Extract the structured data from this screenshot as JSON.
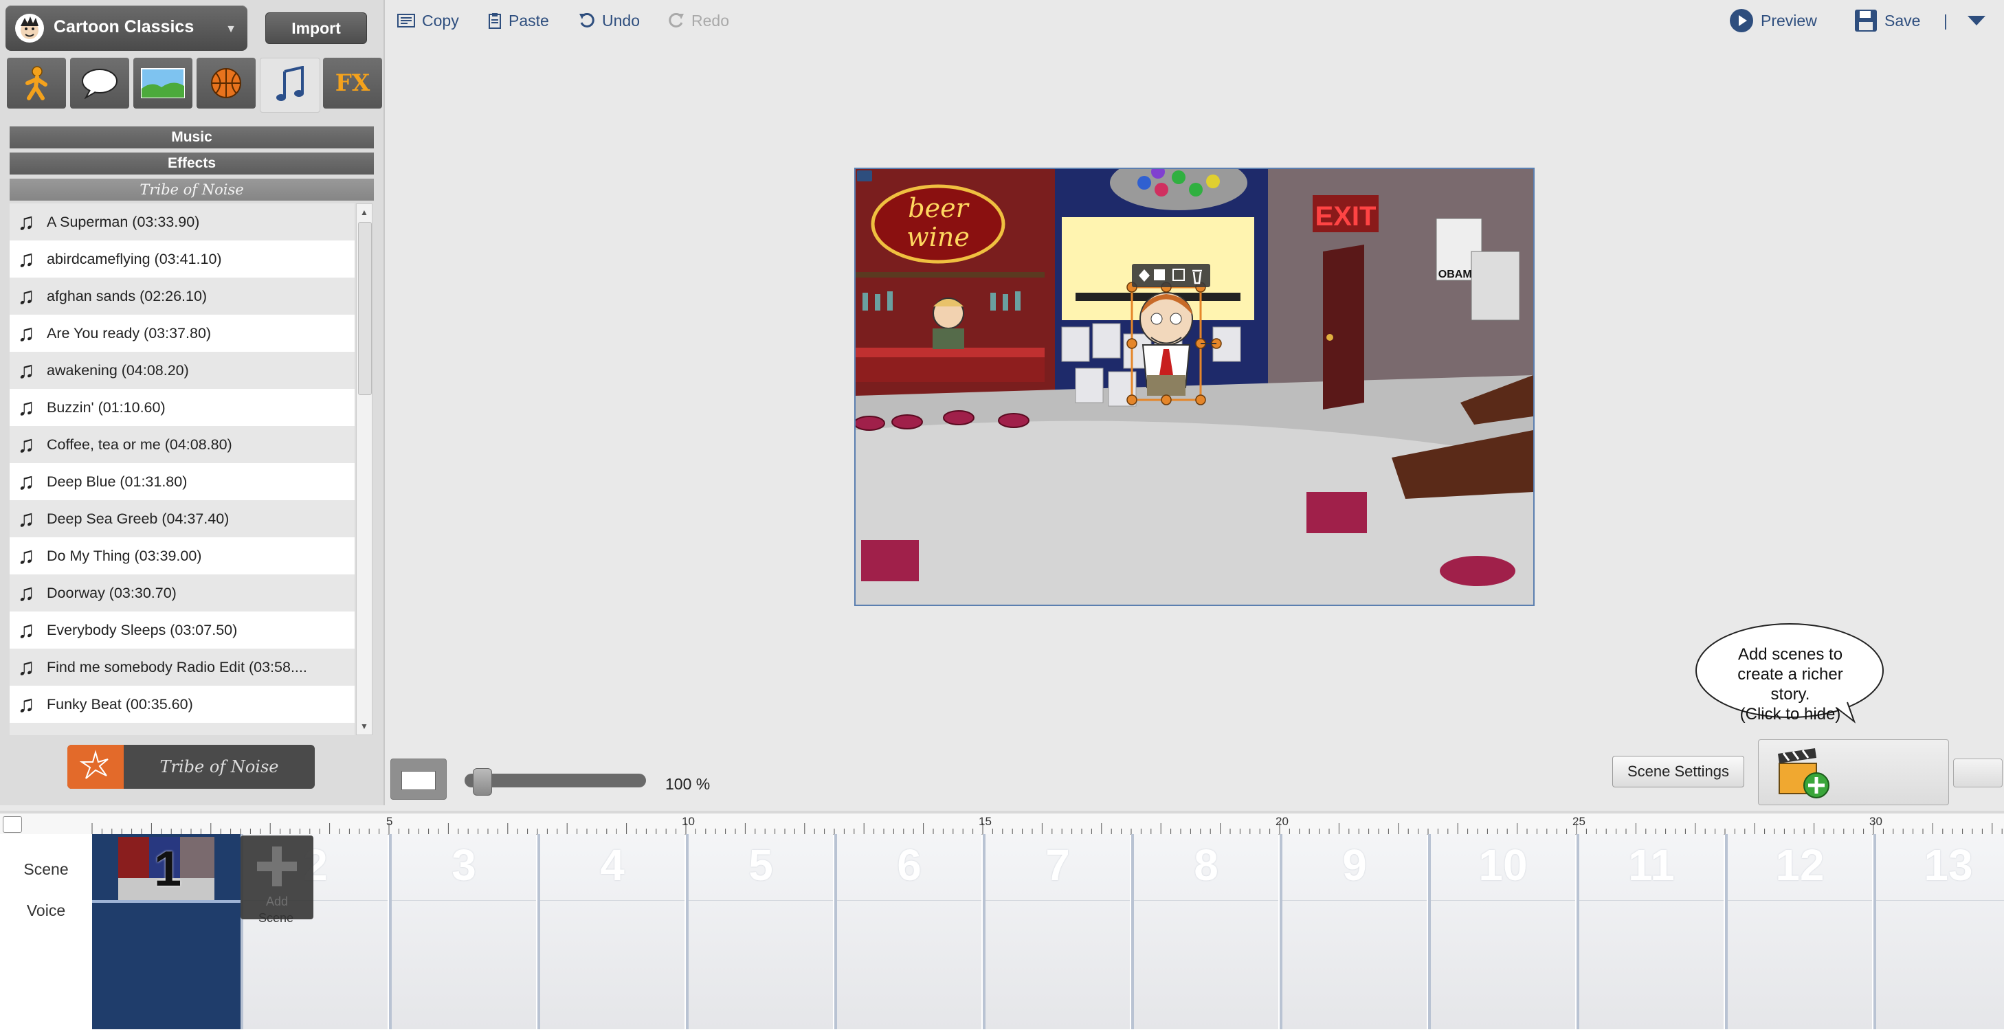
{
  "theme": {
    "name": "Cartoon Classics",
    "import_label": "Import"
  },
  "category_tabs": [
    {
      "name": "characters",
      "icon": "walking-person-icon"
    },
    {
      "name": "dialogue",
      "icon": "speech-bubble-icon"
    },
    {
      "name": "backgrounds",
      "icon": "landscape-icon"
    },
    {
      "name": "props",
      "icon": "basketball-icon"
    },
    {
      "name": "sound",
      "icon": "music-note-icon",
      "active": true
    },
    {
      "name": "effects",
      "label": "FX"
    }
  ],
  "sections": {
    "music": "Music",
    "effects": "Effects",
    "tribe": "Tribe of Noise"
  },
  "tracks": [
    "A Superman (03:33.90)",
    "abirdcameflying (03:41.10)",
    "afghan sands (02:26.10)",
    "Are You ready (03:37.80)",
    "awakening (04:08.20)",
    "Buzzin' (01:10.60)",
    "Coffee, tea or me (04:08.80)",
    "Deep Blue (01:31.80)",
    "Deep Sea Greeb (04:37.40)",
    "Do My Thing (03:39.00)",
    "Doorway (03:30.70)",
    "Everybody Sleeps (03:07.50)",
    "Find me somebody Radio Edit (03:58....",
    "Funky Beat (00:35.60)"
  ],
  "tribe_badge_label": "Tribe of Noise",
  "toolbar": {
    "copy": "Copy",
    "paste": "Paste",
    "undo": "Undo",
    "redo": "Redo",
    "preview": "Preview",
    "save": "Save",
    "separator": "|"
  },
  "stage": {
    "exit_sign": "EXIT",
    "bar_sign_line1": "beer",
    "bar_sign_line2": "wine",
    "poster_text": "OBAMA"
  },
  "zoom": {
    "percent_label": "100 %",
    "value_percent": 100
  },
  "scene_settings_label": "Scene Settings",
  "tip": {
    "lines": [
      "Add scenes to",
      "create a richer",
      "story.",
      "(Click to hide)"
    ]
  },
  "timeline": {
    "ruler_numbers": [
      "5",
      "10",
      "15",
      "20",
      "25",
      "30"
    ],
    "row_labels": {
      "scene": "Scene",
      "voice": "Voice"
    },
    "scene_numbers": [
      "2",
      "3",
      "4",
      "5",
      "6",
      "7",
      "8",
      "9",
      "10",
      "11",
      "12",
      "13"
    ],
    "first_scene_number": "1",
    "add_tile_label": "Add",
    "add_tile_sub": "Scene"
  },
  "colors": {
    "accent_blue": "#2e4e7e",
    "timeline_scene": "#1f3d6b",
    "handle_orange": "#e5862a"
  }
}
